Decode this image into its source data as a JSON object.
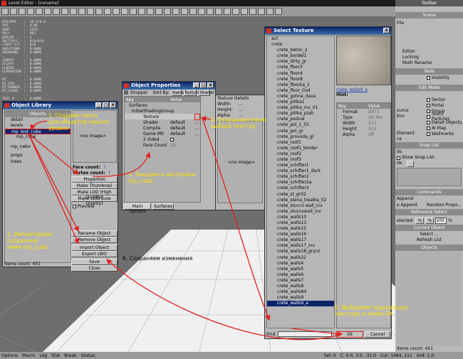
{
  "app": {
    "title": "Level Editor - [noname]",
    "status_bar": {
      "options": "Options",
      "macro": "Macro",
      "log": "Log",
      "stat": "Stat",
      "break": "Break",
      "status": "Status:",
      "sel": "Sel: 0",
      "coords": "C: 0.0, 3.0, -31.0",
      "cursor": "Cur: 1084, 111",
      "grid": "Grd: 1.0"
    },
    "stats_text": "FPS/RPS    :  18.5/0.0\nTPS        :  0.00\nVERT       :  1676\nPOLY       :  402\nDIP/DP     :  5\nSH/T/R/C   :  0/0/0/0\nLIGHT S/T  :  0/0\nSKELETONS  :  0.00MS\nSKINNING   :  0.00MS\n\nIINPUT     :  0.00MS\nZCLRAY     :  0.00MS\nCLBEDS     :  0.00MS\nCLPROUTINE :  0.00MS\n\nDT_        :  0.00MS\nDT_UTB     :  0.00MS\nDT_RENDER  :  0.00MS\nDT_CACHE   :  0.00MS\n\nTEST 0     :  0.00MS\nTEST 1     :  0.00MS\nTEST 2     :  0.00MS\nTEST 3     :  0.00MS\n\nFRAME TIME :  22.03 DT"
  },
  "right_panel": {
    "toolbar_title": "Toolbar",
    "scene_title": "Scene",
    "file_label": "File",
    "editor_label": "Editor",
    "locking": "Locking",
    "multi_rename": "Multi Rename",
    "tools_title": "Tools",
    "visibility": "Visibility",
    "edit_mode_title": "Edit Mode",
    "edit_modes": [
      "Sector",
      "Portal",
      "Group",
      "Static Particles",
      "Detail Objects",
      "AI Map",
      "Wallmarks"
    ],
    "ource": "ource",
    "env": "Env",
    "element": "Element",
    "ce": "ce",
    "snap_list_title": "Snap List",
    "ds": "ds",
    "show_snap_list": "Show Snap List",
    "de": "de",
    "commands_title": "Commands",
    "append": "Append",
    "e_append": "e Append",
    "random_props": "Random Props...",
    "reference_select_title": "Reference Select",
    "elected": "elected",
    "pct_val": "100",
    "pct_sign": "%",
    "current_object_title": "Current Object",
    "select": "Select ...",
    "refresh_list": "Refresh List",
    "objects_title": "Objects",
    "items_count": "Items count: 451"
  },
  "object_library": {
    "title": "Object Library",
    "header": "Objects",
    "tree": [
      {
        "label": "detail",
        "depth": 0
      },
      {
        "label": "levels",
        "depth": 0
      },
      {
        "label": "mp_test_cube",
        "depth": 0
      },
      {
        "label": "mp_cube",
        "depth": 1
      },
      {
        "label": "mp_nebo",
        "depth": 0
      },
      {
        "label": "props",
        "depth": 0
      },
      {
        "label": "trees",
        "depth": 0
      }
    ],
    "no_image": "<no image>",
    "face_count_label": "Face count:",
    "face_count": "?",
    "vertex_count_label": "Vertex count:",
    "vertex_count": "?",
    "buttons": [
      "Properties",
      "Make Thumbnail",
      "Make LOD (High Quality)",
      "Make LOD (Low Quality)"
    ],
    "preview": "Preview",
    "buttons2": [
      "Rename Object",
      "Remove Object",
      "Import Object",
      "Export LWO"
    ],
    "save": "Save",
    "close": "Close",
    "items_count": "Items count: 451"
  },
  "object_properties": {
    "title": "Object Properties",
    "dropper": "Dropper",
    "sort_by": "Sort By:",
    "sort_options": [
      "Name",
      "Texture",
      "Shader"
    ],
    "col_key": "Key",
    "col_value": "Value",
    "rows": [
      {
        "key": "Surfaces",
        "value": "",
        "depth": 0
      },
      {
        "key": "initialShadingGroup",
        "value": "",
        "depth": 1
      },
      {
        "key": "Texture",
        "value": "",
        "depth": 2
      },
      {
        "key": "Shader",
        "value": "default",
        "depth": 2
      },
      {
        "key": "Compile",
        "value": "default",
        "depth": 2
      },
      {
        "key": "Game Mtl",
        "value": "default",
        "depth": 2
      },
      {
        "key": "2 Sided",
        "value": "",
        "depth": 2
      },
      {
        "key": "Face Count",
        "value": "10",
        "depth": 2
      }
    ],
    "texture_details": "Texture Details",
    "width": "Width:",
    "height": "Height:",
    "alpha": "Alpha:",
    "dots": "...",
    "no_image": "<no image>",
    "tabs": [
      "Main Options",
      "Surfaces"
    ]
  },
  "select_texture": {
    "title": "Select Texture",
    "items": [
      "act",
      "crete",
      "crete_beton_2",
      "crete_bordel1",
      "crete_dirty_gr",
      "crete_floor3",
      "crete_floor4",
      "crete_floor8",
      "crete_floorka_1",
      "crete_floor_tiod",
      "crete_golina_dava",
      "crete_plitka1",
      "crete_plitka_inv_01",
      "crete_plitka_plab",
      "crete_podval",
      "crete_pol_1_01",
      "crete_pol_gr",
      "crete_provoda_gl",
      "crete_roof1",
      "crete_roof1_border",
      "crete_roof2",
      "crete_roof3",
      "crete_schifter1",
      "crete_schifter1_dark",
      "crete_schifter2",
      "crete_schifter2a",
      "crete_schifter3",
      "crete_st_gr02",
      "crete_stena_trealka_02",
      "crete_stucco wall_inv",
      "crete_stuccowall_inv",
      "crete_walls10",
      "crete_walls13",
      "crete_walls15",
      "crete_walls16",
      "crete_walls17",
      "crete_walls17_inv",
      "crete_walls18_grycz",
      "crete_walls22",
      "crete_walls4",
      "crete_walls5",
      "crete_walls6",
      "crete_walls7",
      "crete_walls8",
      "crete_walls8d",
      "crete_walls9",
      "crete_walls9_a"
    ],
    "selected_index": 46,
    "hint": "crete_walls9_a",
    "hint_label": "Hint:",
    "props_header_key": "Key",
    "props_header_value": "Value",
    "props": [
      {
        "key": "Format",
        "value": "DXT1"
      },
      {
        "key": "Type",
        "value": "2D Tex"
      },
      {
        "key": "Width",
        "value": "512"
      },
      {
        "key": "Height",
        "value": "512"
      },
      {
        "key": "Alpha",
        "value": "off"
      }
    ],
    "find": "Find",
    "ok": "Ok",
    "cancel": "Cancel"
  },
  "annotations": {
    "a1": "1. Создаём папку\nдля объектов нашего\nуровня",
    "a2": "2. Импортируем\nсозданный\nнами mp_cube",
    "a3": "3. Заходим в настройки\nmp_cube",
    "a4": "4. Открываем меню\nвыбора текстур",
    "a5": "5. Выбираем подходящую\nтекстуру и жмём ОК",
    "a6": "6. Сохраняем изменения"
  },
  "colors": {
    "annotation": "#ffe400",
    "arrow": "#e02020",
    "title_bar": "#0a246a",
    "selection": "#0a246a"
  }
}
